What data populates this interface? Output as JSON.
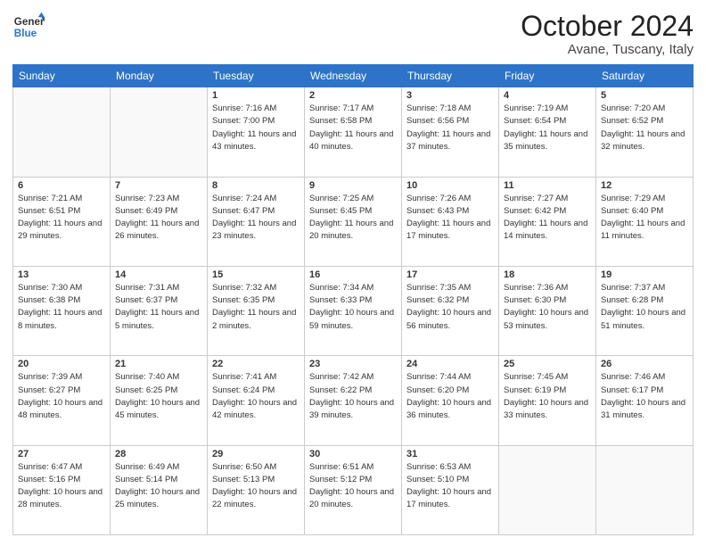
{
  "logo": {
    "line1": "General",
    "line2": "Blue"
  },
  "header": {
    "month": "October 2024",
    "location": "Avane, Tuscany, Italy"
  },
  "weekdays": [
    "Sunday",
    "Monday",
    "Tuesday",
    "Wednesday",
    "Thursday",
    "Friday",
    "Saturday"
  ],
  "weeks": [
    [
      {
        "day": "",
        "sunrise": "",
        "sunset": "",
        "daylight": ""
      },
      {
        "day": "",
        "sunrise": "",
        "sunset": "",
        "daylight": ""
      },
      {
        "day": "1",
        "sunrise": "Sunrise: 7:16 AM",
        "sunset": "Sunset: 7:00 PM",
        "daylight": "Daylight: 11 hours and 43 minutes."
      },
      {
        "day": "2",
        "sunrise": "Sunrise: 7:17 AM",
        "sunset": "Sunset: 6:58 PM",
        "daylight": "Daylight: 11 hours and 40 minutes."
      },
      {
        "day": "3",
        "sunrise": "Sunrise: 7:18 AM",
        "sunset": "Sunset: 6:56 PM",
        "daylight": "Daylight: 11 hours and 37 minutes."
      },
      {
        "day": "4",
        "sunrise": "Sunrise: 7:19 AM",
        "sunset": "Sunset: 6:54 PM",
        "daylight": "Daylight: 11 hours and 35 minutes."
      },
      {
        "day": "5",
        "sunrise": "Sunrise: 7:20 AM",
        "sunset": "Sunset: 6:52 PM",
        "daylight": "Daylight: 11 hours and 32 minutes."
      }
    ],
    [
      {
        "day": "6",
        "sunrise": "Sunrise: 7:21 AM",
        "sunset": "Sunset: 6:51 PM",
        "daylight": "Daylight: 11 hours and 29 minutes."
      },
      {
        "day": "7",
        "sunrise": "Sunrise: 7:23 AM",
        "sunset": "Sunset: 6:49 PM",
        "daylight": "Daylight: 11 hours and 26 minutes."
      },
      {
        "day": "8",
        "sunrise": "Sunrise: 7:24 AM",
        "sunset": "Sunset: 6:47 PM",
        "daylight": "Daylight: 11 hours and 23 minutes."
      },
      {
        "day": "9",
        "sunrise": "Sunrise: 7:25 AM",
        "sunset": "Sunset: 6:45 PM",
        "daylight": "Daylight: 11 hours and 20 minutes."
      },
      {
        "day": "10",
        "sunrise": "Sunrise: 7:26 AM",
        "sunset": "Sunset: 6:43 PM",
        "daylight": "Daylight: 11 hours and 17 minutes."
      },
      {
        "day": "11",
        "sunrise": "Sunrise: 7:27 AM",
        "sunset": "Sunset: 6:42 PM",
        "daylight": "Daylight: 11 hours and 14 minutes."
      },
      {
        "day": "12",
        "sunrise": "Sunrise: 7:29 AM",
        "sunset": "Sunset: 6:40 PM",
        "daylight": "Daylight: 11 hours and 11 minutes."
      }
    ],
    [
      {
        "day": "13",
        "sunrise": "Sunrise: 7:30 AM",
        "sunset": "Sunset: 6:38 PM",
        "daylight": "Daylight: 11 hours and 8 minutes."
      },
      {
        "day": "14",
        "sunrise": "Sunrise: 7:31 AM",
        "sunset": "Sunset: 6:37 PM",
        "daylight": "Daylight: 11 hours and 5 minutes."
      },
      {
        "day": "15",
        "sunrise": "Sunrise: 7:32 AM",
        "sunset": "Sunset: 6:35 PM",
        "daylight": "Daylight: 11 hours and 2 minutes."
      },
      {
        "day": "16",
        "sunrise": "Sunrise: 7:34 AM",
        "sunset": "Sunset: 6:33 PM",
        "daylight": "Daylight: 10 hours and 59 minutes."
      },
      {
        "day": "17",
        "sunrise": "Sunrise: 7:35 AM",
        "sunset": "Sunset: 6:32 PM",
        "daylight": "Daylight: 10 hours and 56 minutes."
      },
      {
        "day": "18",
        "sunrise": "Sunrise: 7:36 AM",
        "sunset": "Sunset: 6:30 PM",
        "daylight": "Daylight: 10 hours and 53 minutes."
      },
      {
        "day": "19",
        "sunrise": "Sunrise: 7:37 AM",
        "sunset": "Sunset: 6:28 PM",
        "daylight": "Daylight: 10 hours and 51 minutes."
      }
    ],
    [
      {
        "day": "20",
        "sunrise": "Sunrise: 7:39 AM",
        "sunset": "Sunset: 6:27 PM",
        "daylight": "Daylight: 10 hours and 48 minutes."
      },
      {
        "day": "21",
        "sunrise": "Sunrise: 7:40 AM",
        "sunset": "Sunset: 6:25 PM",
        "daylight": "Daylight: 10 hours and 45 minutes."
      },
      {
        "day": "22",
        "sunrise": "Sunrise: 7:41 AM",
        "sunset": "Sunset: 6:24 PM",
        "daylight": "Daylight: 10 hours and 42 minutes."
      },
      {
        "day": "23",
        "sunrise": "Sunrise: 7:42 AM",
        "sunset": "Sunset: 6:22 PM",
        "daylight": "Daylight: 10 hours and 39 minutes."
      },
      {
        "day": "24",
        "sunrise": "Sunrise: 7:44 AM",
        "sunset": "Sunset: 6:20 PM",
        "daylight": "Daylight: 10 hours and 36 minutes."
      },
      {
        "day": "25",
        "sunrise": "Sunrise: 7:45 AM",
        "sunset": "Sunset: 6:19 PM",
        "daylight": "Daylight: 10 hours and 33 minutes."
      },
      {
        "day": "26",
        "sunrise": "Sunrise: 7:46 AM",
        "sunset": "Sunset: 6:17 PM",
        "daylight": "Daylight: 10 hours and 31 minutes."
      }
    ],
    [
      {
        "day": "27",
        "sunrise": "Sunrise: 6:47 AM",
        "sunset": "Sunset: 5:16 PM",
        "daylight": "Daylight: 10 hours and 28 minutes."
      },
      {
        "day": "28",
        "sunrise": "Sunrise: 6:49 AM",
        "sunset": "Sunset: 5:14 PM",
        "daylight": "Daylight: 10 hours and 25 minutes."
      },
      {
        "day": "29",
        "sunrise": "Sunrise: 6:50 AM",
        "sunset": "Sunset: 5:13 PM",
        "daylight": "Daylight: 10 hours and 22 minutes."
      },
      {
        "day": "30",
        "sunrise": "Sunrise: 6:51 AM",
        "sunset": "Sunset: 5:12 PM",
        "daylight": "Daylight: 10 hours and 20 minutes."
      },
      {
        "day": "31",
        "sunrise": "Sunrise: 6:53 AM",
        "sunset": "Sunset: 5:10 PM",
        "daylight": "Daylight: 10 hours and 17 minutes."
      },
      {
        "day": "",
        "sunrise": "",
        "sunset": "",
        "daylight": ""
      },
      {
        "day": "",
        "sunrise": "",
        "sunset": "",
        "daylight": ""
      }
    ]
  ]
}
